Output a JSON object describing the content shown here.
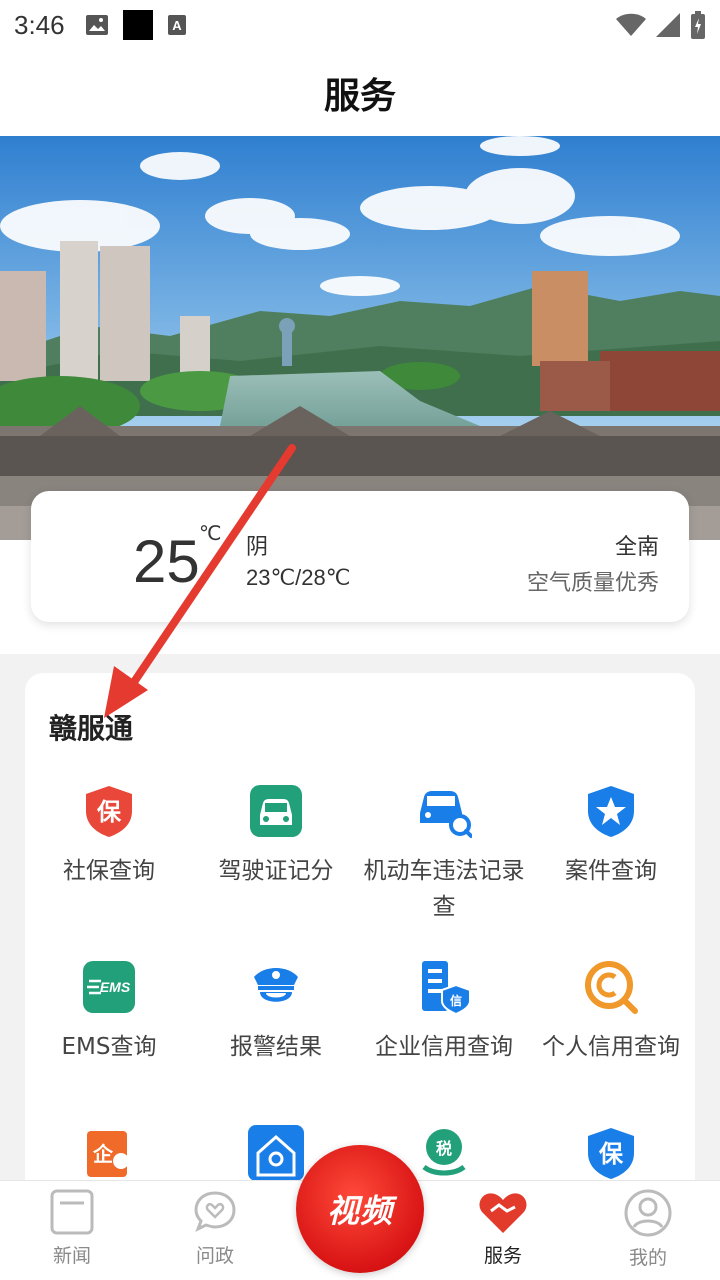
{
  "status": {
    "time": "3:46"
  },
  "header": {
    "title": "服务"
  },
  "weather": {
    "temp": "25",
    "unit": "℃",
    "condition": "阴",
    "range": "23℃/28℃",
    "city": "全南",
    "air": "空气质量优秀"
  },
  "services": {
    "title": "赣服通",
    "items": [
      {
        "label": "社保查询",
        "icon": "shield-bao-icon"
      },
      {
        "label": "驾驶证记分",
        "icon": "car-icon"
      },
      {
        "label": "机动车违法记录查",
        "icon": "car-search-icon"
      },
      {
        "label": "案件查询",
        "icon": "police-shield-icon"
      },
      {
        "label": "EMS查询",
        "icon": "ems-icon"
      },
      {
        "label": "报警结果",
        "icon": "police-hat-icon"
      },
      {
        "label": "企业信用查询",
        "icon": "building-credit-icon"
      },
      {
        "label": "个人信用查询",
        "icon": "credit-search-icon"
      }
    ]
  },
  "bottom_nav": {
    "news": "新闻",
    "politics": "问政",
    "video": "视频",
    "service": "服务",
    "mine": "我的"
  },
  "colors": {
    "accent_red": "#e23b2c",
    "teal": "#22a07a",
    "blue": "#1a7ee8",
    "orange": "#f0992a"
  }
}
